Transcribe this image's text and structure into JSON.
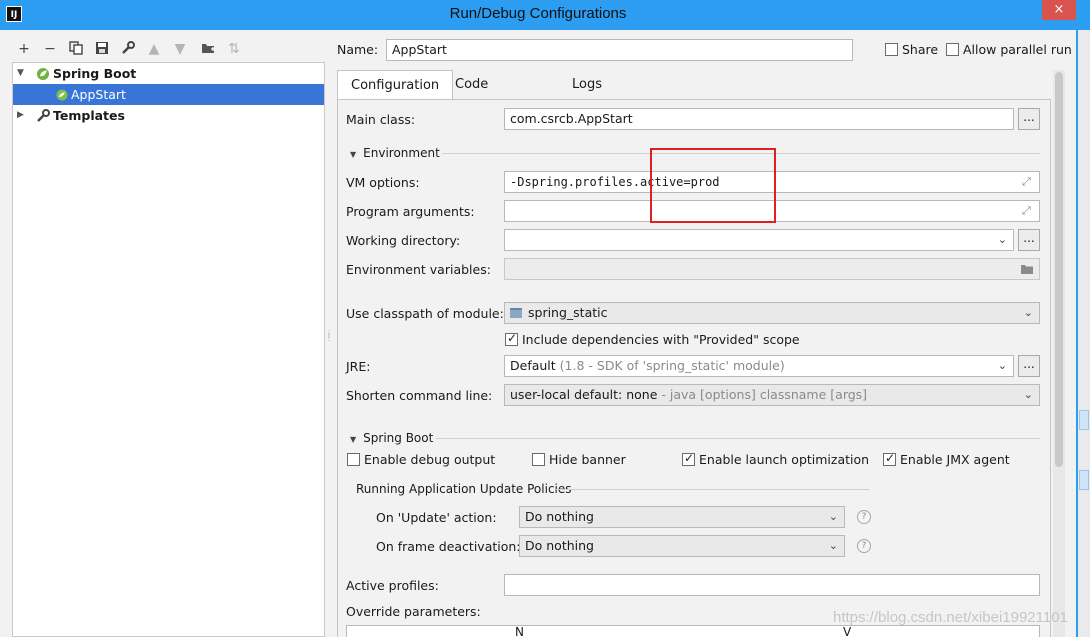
{
  "window": {
    "title": "Run/Debug Configurations",
    "app_icon": "IJ",
    "close_glyph": "×"
  },
  "toolbar": {
    "icons": [
      "add-icon",
      "remove-icon",
      "copy-icon",
      "save-icon",
      "wrench-icon",
      "move-up-icon",
      "move-down-icon",
      "new-folder-icon",
      "sort-icon"
    ]
  },
  "tree": {
    "spring_boot": "Spring Boot",
    "app_start": "AppStart",
    "templates": "Templates"
  },
  "header": {
    "name_label": "Name:",
    "name_value": "AppStart",
    "share_label": "Share",
    "share_checked": false,
    "parallel_label": "Allow parallel run",
    "parallel_checked": false
  },
  "tabs": [
    {
      "label": "Configuration",
      "active": true
    },
    {
      "label": "Code Coverage",
      "active": false
    },
    {
      "label": "Logs",
      "active": false
    }
  ],
  "form": {
    "main_class_label": "Main class:",
    "main_class_value": "com.csrcb.AppStart",
    "environment_section": "Environment",
    "vm_options_label": "VM options:",
    "vm_options_value": "-Dspring.profiles.active=prod",
    "program_args_label": "Program arguments:",
    "program_args_value": "",
    "working_dir_label": "Working directory:",
    "working_dir_value": "",
    "env_vars_label": "Environment variables:",
    "env_vars_value": "",
    "classpath_label": "Use classpath of module:",
    "classpath_value": "spring_static",
    "include_deps_label": "Include dependencies with \"Provided\" scope",
    "include_deps_checked": true,
    "jre_label": "JRE:",
    "jre_value": "Default",
    "jre_hint": "(1.8 - SDK of 'spring_static' module)",
    "shorten_label": "Shorten command line:",
    "shorten_value": "user-local default: none",
    "shorten_hint": " - java [options] classname [args]",
    "spring_boot_section": "Spring Boot",
    "debug_output_label": "Enable debug output",
    "debug_output_checked": false,
    "hide_banner_label": "Hide banner",
    "hide_banner_checked": false,
    "launch_opt_label": "Enable launch optimization",
    "launch_opt_checked": true,
    "jmx_label": "Enable JMX agent",
    "jmx_checked": true,
    "policies_section": "Running Application Update Policies",
    "on_update_label": "On 'Update' action:",
    "on_update_value": "Do nothing",
    "on_frame_label": "On frame deactivation:",
    "on_frame_value": "Do nothing",
    "active_profiles_label": "Active profiles:",
    "active_profiles_value": "",
    "override_label": "Override parameters:",
    "table_col_name": "N",
    "table_col_value": "V"
  },
  "watermark": "https://blog.csdn.net/xibei19921101",
  "colors": {
    "titlebar": "#2c9df0",
    "selection": "#3875d7",
    "highlight_box": "#e02020"
  }
}
